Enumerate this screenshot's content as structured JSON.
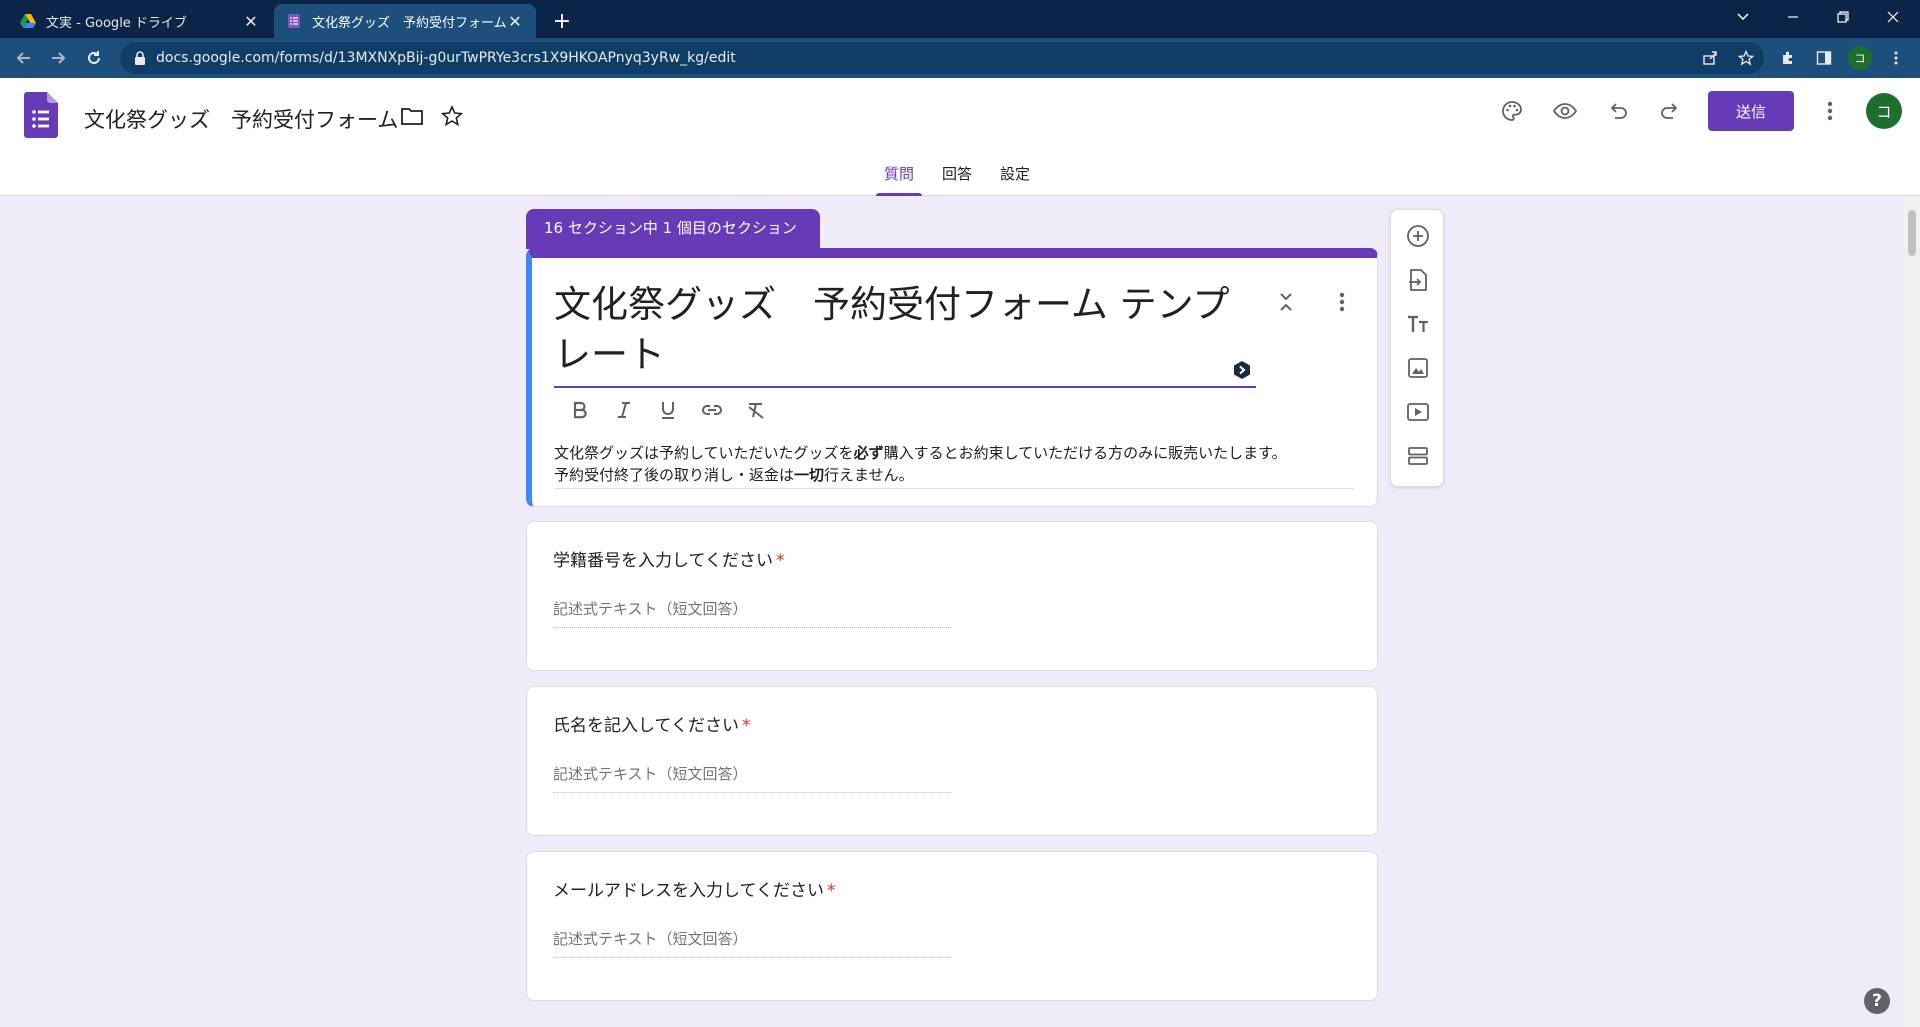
{
  "browser": {
    "tabs": [
      {
        "title": "文実 - Google ドライブ",
        "icon": "google-drive-icon"
      },
      {
        "title": "文化祭グッズ　予約受付フォーム - G",
        "icon": "google-forms-icon"
      }
    ],
    "tab_close": "✕",
    "new_tab": "+",
    "url": "docs.google.com/forms/d/13MXNXpBij-g0urTwPRYe3crs1X9HKOAPnyq3yRw_kg/edit",
    "profile_initial": "コ"
  },
  "header": {
    "doc_title": "文化祭グッズ　予約受付フォーム",
    "send_label": "送信",
    "avatar_initial": "コ",
    "tabs": [
      "質問",
      "回答",
      "設定"
    ],
    "active_tab": 0
  },
  "form": {
    "section_label": "16 セクション中 1 個目のセクション",
    "title": "文化祭グッズ　予約受付フォーム テンプレート",
    "description": {
      "line1_a": "文化祭グッズは予約していただいたグッズを",
      "line1_bold": "必ず",
      "line1_b": "購入するとお約束していただける方のみに販売いたします。",
      "line2_a": "予約受付終了後の取り消し・返金は",
      "line2_bold": "一切",
      "line2_b": "行えません。"
    },
    "questions": [
      {
        "title": "学籍番号を入力してください",
        "required_mark": "*",
        "placeholder": "記述式テキスト（短文回答）"
      },
      {
        "title": "氏名を記入してください",
        "required_mark": "*",
        "placeholder": "記述式テキスト（短文回答）"
      },
      {
        "title": "メールアドレスを入力してください",
        "required_mark": "*",
        "placeholder": "記述式テキスト（短文回答）"
      }
    ]
  },
  "help_label": "?",
  "colors": {
    "accent": "#673ab7",
    "background": "#f0ebf8",
    "required": "#d93025",
    "chrome": "#0b2447"
  }
}
